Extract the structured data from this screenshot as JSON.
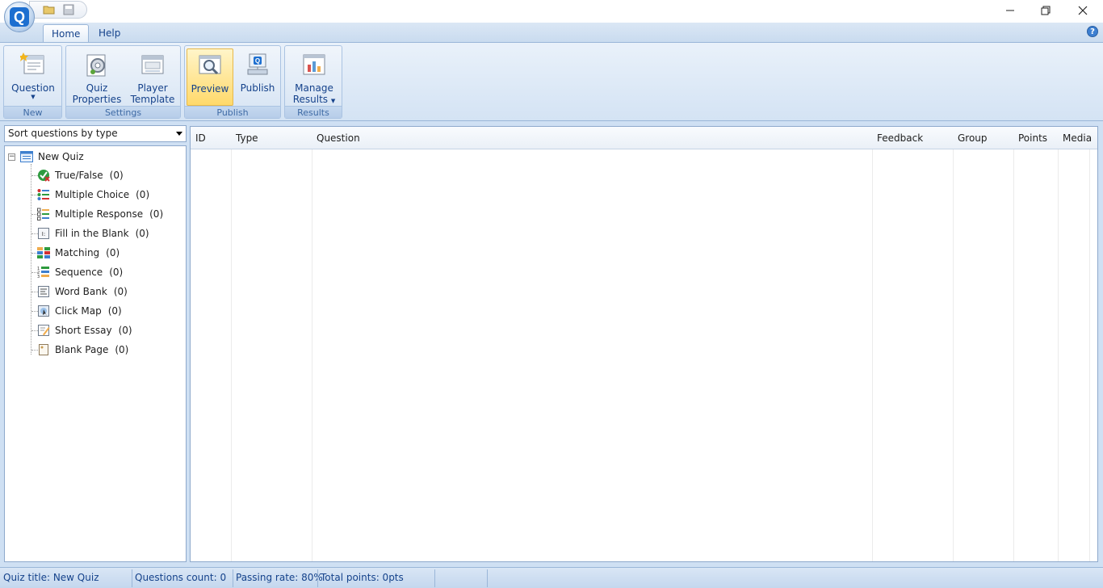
{
  "titlebar": {
    "minimize_glyph": "—",
    "restore_glyph": "❐",
    "close_glyph": "✕"
  },
  "tabs": [
    {
      "label": "Home"
    },
    {
      "label": "Help"
    }
  ],
  "help_glyph": "?",
  "ribbon": {
    "groups": {
      "new": "New",
      "settings": "Settings",
      "publish": "Publish",
      "results": "Results"
    },
    "buttons": {
      "question": "Question",
      "quiz_properties_1": "Quiz",
      "quiz_properties_2": "Properties",
      "player_template_1": "Player",
      "player_template_2": "Template",
      "preview": "Preview",
      "publish": "Publish",
      "manage_results_1": "Manage",
      "manage_results_2": "Results"
    }
  },
  "sort": {
    "selected": "Sort questions by type"
  },
  "tree": {
    "root": "New Quiz",
    "items": [
      {
        "label": "True/False",
        "count": "(0)"
      },
      {
        "label": "Multiple Choice",
        "count": "(0)"
      },
      {
        "label": "Multiple Response",
        "count": "(0)"
      },
      {
        "label": "Fill in the Blank",
        "count": "(0)"
      },
      {
        "label": "Matching",
        "count": "(0)"
      },
      {
        "label": "Sequence",
        "count": "(0)"
      },
      {
        "label": "Word Bank",
        "count": "(0)"
      },
      {
        "label": "Click Map",
        "count": "(0)"
      },
      {
        "label": "Short Essay",
        "count": "(0)"
      },
      {
        "label": "Blank Page",
        "count": "(0)"
      }
    ]
  },
  "grid": {
    "columns": [
      "ID",
      "Type",
      "Question",
      "Feedback",
      "Group",
      "Points",
      "Media"
    ]
  },
  "status": {
    "quiz_title": "Quiz title: New Quiz",
    "questions_count": "Questions count: 0",
    "passing_rate": "Passing rate: 80%",
    "total_points": "Total points: 0pts"
  },
  "colors": {
    "ribbon_text": "#15428b",
    "highlight": "#ffd96b",
    "frame": "#cfe0f3"
  }
}
